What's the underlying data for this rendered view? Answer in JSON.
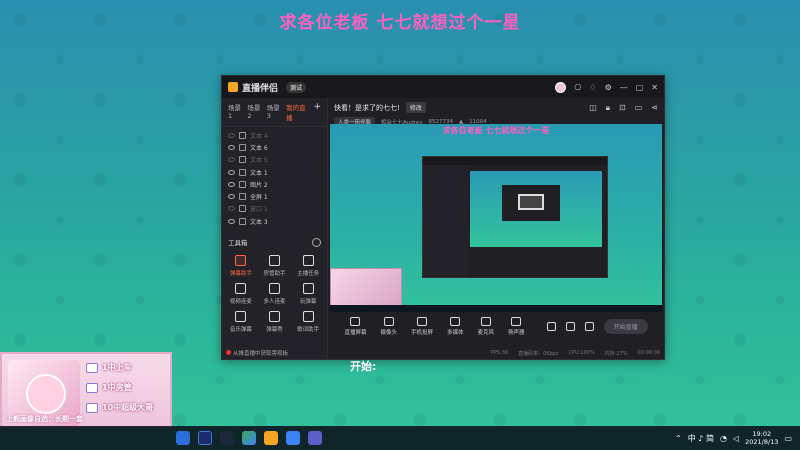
{
  "banner": "求各位老板 七七就想过个一星",
  "window": {
    "app_name": "直播伴侣",
    "version_badge": "测试",
    "scene_tabs": [
      "场景1",
      "场景2",
      "场景3",
      "我的直播"
    ],
    "sources": [
      {
        "label": "文本 4",
        "dim": true
      },
      {
        "label": "文本 6",
        "dim": false
      },
      {
        "label": "文本 5",
        "dim": true
      },
      {
        "label": "文本 1",
        "dim": false
      },
      {
        "label": "图片 2",
        "dim": false
      },
      {
        "label": "全屏 1",
        "dim": false
      },
      {
        "label": "窗口 1",
        "dim": true
      },
      {
        "label": "文本 3",
        "dim": false
      }
    ],
    "tools_header": "工具箱",
    "tools": [
      "弹幕助手",
      "房管助手",
      "主播任务",
      "视频连麦",
      "多人连麦",
      "玩弹幕",
      "音乐弹幕",
      "弹幕秀",
      "歌词助手"
    ],
    "left_footer": "从推直播中获取旁观板",
    "title_line": "快看！是求了的七七!",
    "edit_label": "修改",
    "category": "人类一陪伴聊",
    "host_line": "相会七七Audrey",
    "room_id": "8527734",
    "heat": "11004",
    "preview_banner": "求各位老板 七七就想过个一星",
    "dock": [
      {
        "label": "直播屏幕",
        "icon": "screen-icon"
      },
      {
        "label": "摄像头",
        "icon": "camera-icon"
      },
      {
        "label": "手机投屏",
        "icon": "phone-cast-icon"
      },
      {
        "label": "多媒体",
        "icon": "media-icon"
      },
      {
        "label": "麦克风",
        "icon": "mic-icon"
      },
      {
        "label": "扬声器",
        "icon": "speaker-icon"
      }
    ],
    "start_live": "开始直播",
    "status": [
      "PPS:30",
      "直播码率：0Kbps",
      "CPU:100%",
      "内存:27%",
      "00:00:00"
    ]
  },
  "open_text": "开始:",
  "overlay": {
    "rows": [
      "1中上车",
      "1中房管",
      "10中超级大哥"
    ],
    "bottom": "上舰画像自选：长期一套"
  },
  "taskbar": {
    "lang": "中 ♪ 简",
    "time": "19:02",
    "date": "2021/8/13"
  }
}
